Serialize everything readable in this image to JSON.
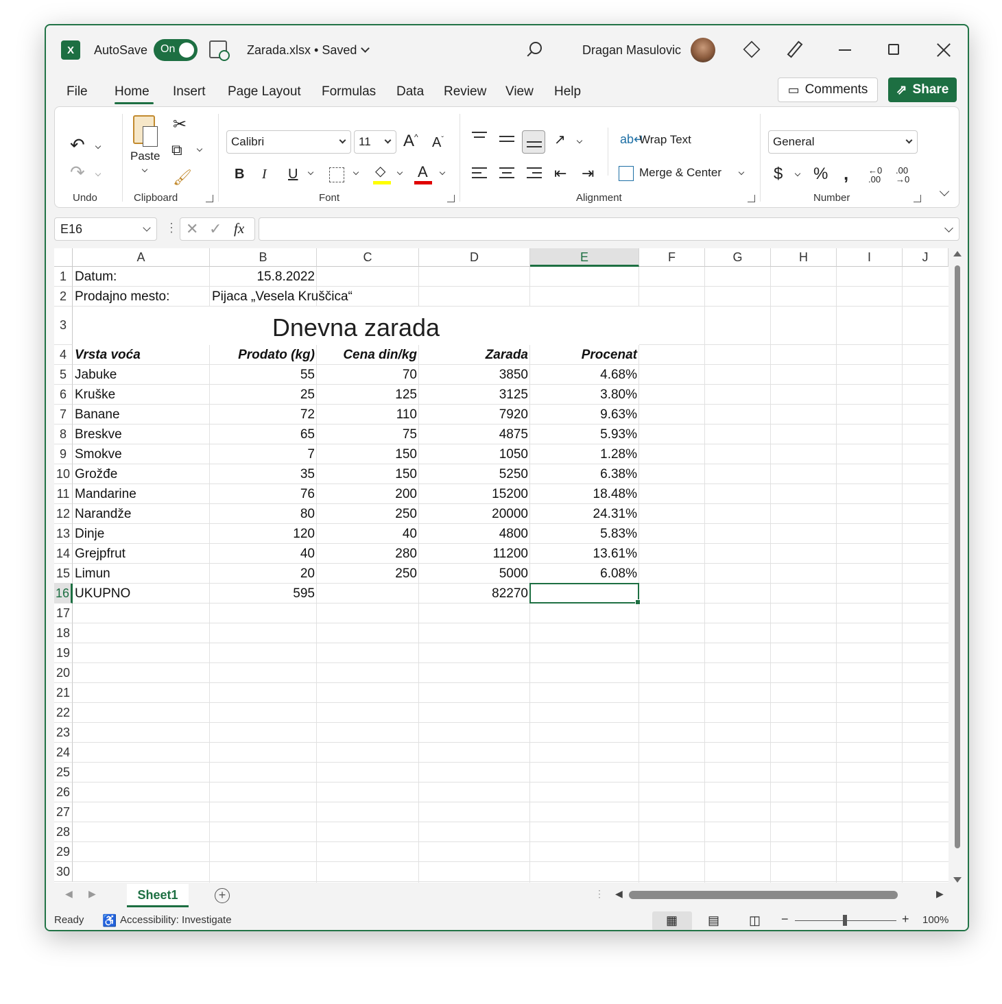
{
  "title_bar": {
    "app_icon": "excel-icon",
    "autosave_label": "AutoSave",
    "autosave_state": "On",
    "document_title": "Zarada.xlsx • Saved",
    "user_name": "Dragan Masulovic"
  },
  "menu": {
    "tabs": [
      "File",
      "Home",
      "Insert",
      "Page Layout",
      "Formulas",
      "Data",
      "Review",
      "View",
      "Help"
    ],
    "active_tab": "Home",
    "comments_label": "Comments",
    "share_label": "Share"
  },
  "ribbon": {
    "groups": {
      "undo": "Undo",
      "clipboard": "Clipboard",
      "font": "Font",
      "alignment": "Alignment",
      "number": "Number"
    },
    "paste_label": "Paste",
    "font_name": "Calibri",
    "font_size": "11",
    "wrap_text_label": "Wrap Text",
    "merge_center_label": "Merge & Center",
    "number_format": "General",
    "bold": "B",
    "italic": "I",
    "underline": "U"
  },
  "formula_bar": {
    "name_box": "E16",
    "fx": "fx",
    "formula": ""
  },
  "columns": [
    "A",
    "B",
    "C",
    "D",
    "E",
    "F",
    "G",
    "H",
    "I",
    "J"
  ],
  "selected_column": "E",
  "selected_row": "16",
  "rows": [
    "1",
    "2",
    "3",
    "4",
    "5",
    "6",
    "7",
    "8",
    "9",
    "10",
    "11",
    "12",
    "13",
    "14",
    "15",
    "16",
    "17",
    "18",
    "19",
    "20",
    "21",
    "22",
    "23",
    "24",
    "25",
    "26",
    "27",
    "28",
    "29",
    "30"
  ],
  "sheet": {
    "A1": "Datum:",
    "B1": "15.8.2022",
    "A2": "Prodajno mesto:",
    "B2": "Pijaca „Vesela Kruščica“",
    "title": "Dnevna zarada",
    "headers": [
      "Vrsta voća",
      "Prodato (kg)",
      "Cena din/kg",
      "Zarada",
      "Procenat"
    ],
    "data_rows": [
      [
        "Jabuke",
        "55",
        "70",
        "3850",
        "4.68%"
      ],
      [
        "Kruške",
        "25",
        "125",
        "3125",
        "3.80%"
      ],
      [
        "Banane",
        "72",
        "110",
        "7920",
        "9.63%"
      ],
      [
        "Breskve",
        "65",
        "75",
        "4875",
        "5.93%"
      ],
      [
        "Smokve",
        "7",
        "150",
        "1050",
        "1.28%"
      ],
      [
        "Grožđe",
        "35",
        "150",
        "5250",
        "6.38%"
      ],
      [
        "Mandarine",
        "76",
        "200",
        "15200",
        "18.48%"
      ],
      [
        "Narandže",
        "80",
        "250",
        "20000",
        "24.31%"
      ],
      [
        "Dinje",
        "120",
        "40",
        "4800",
        "5.83%"
      ],
      [
        "Grejpfrut",
        "40",
        "280",
        "11200",
        "13.61%"
      ],
      [
        "Limun",
        "20",
        "250",
        "5000",
        "6.08%"
      ]
    ],
    "total_row": [
      "UKUPNO",
      "595",
      "",
      "82270",
      ""
    ]
  },
  "sheet_tabs": {
    "active": "Sheet1"
  },
  "status_bar": {
    "ready": "Ready",
    "accessibility": "Accessibility: Investigate",
    "zoom": "100%"
  },
  "colors": {
    "accent": "#1d6f42",
    "grid_line": "#e1e1e1",
    "font_color_swatch": "#e00000",
    "highlight_swatch": "#ffff00"
  }
}
